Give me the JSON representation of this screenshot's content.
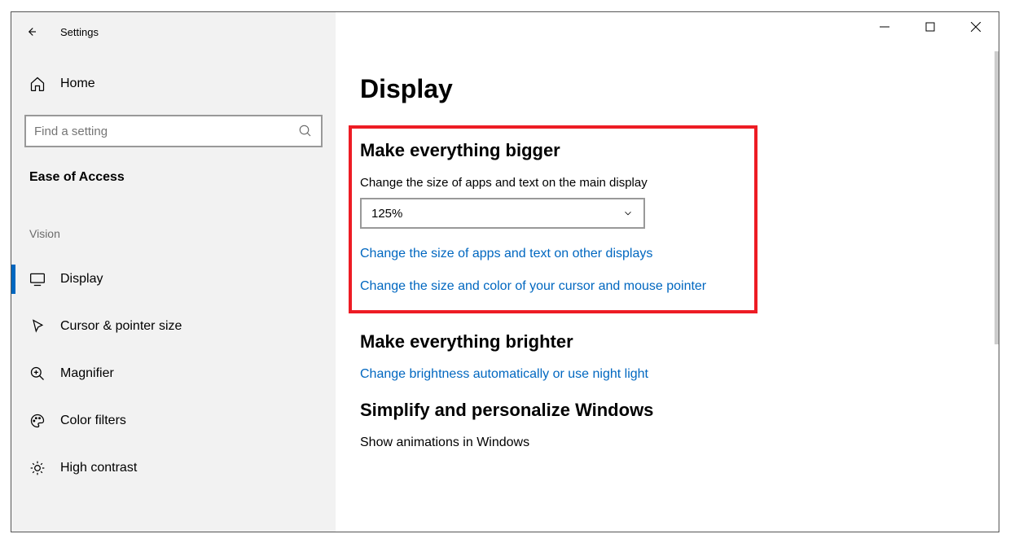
{
  "app": {
    "title": "Settings"
  },
  "sidebar": {
    "home_label": "Home",
    "search_placeholder": "Find a setting",
    "category": "Ease of Access",
    "subheading": "Vision",
    "items": [
      {
        "label": "Display",
        "active": true
      },
      {
        "label": "Cursor & pointer size",
        "active": false
      },
      {
        "label": "Magnifier",
        "active": false
      },
      {
        "label": "Color filters",
        "active": false
      },
      {
        "label": "High contrast",
        "active": false
      }
    ]
  },
  "main": {
    "title": "Display",
    "bigger": {
      "heading": "Make everything bigger",
      "field_label": "Change the size of apps and text on the main display",
      "scale_value": "125%",
      "link_other_displays": "Change the size of apps and text on other displays",
      "link_cursor": "Change the size and color of your cursor and mouse pointer"
    },
    "brighter": {
      "heading": "Make everything brighter",
      "link_brightness": "Change brightness automatically or use night light"
    },
    "simplify": {
      "heading": "Simplify and personalize Windows",
      "animations_label": "Show animations in Windows"
    }
  }
}
